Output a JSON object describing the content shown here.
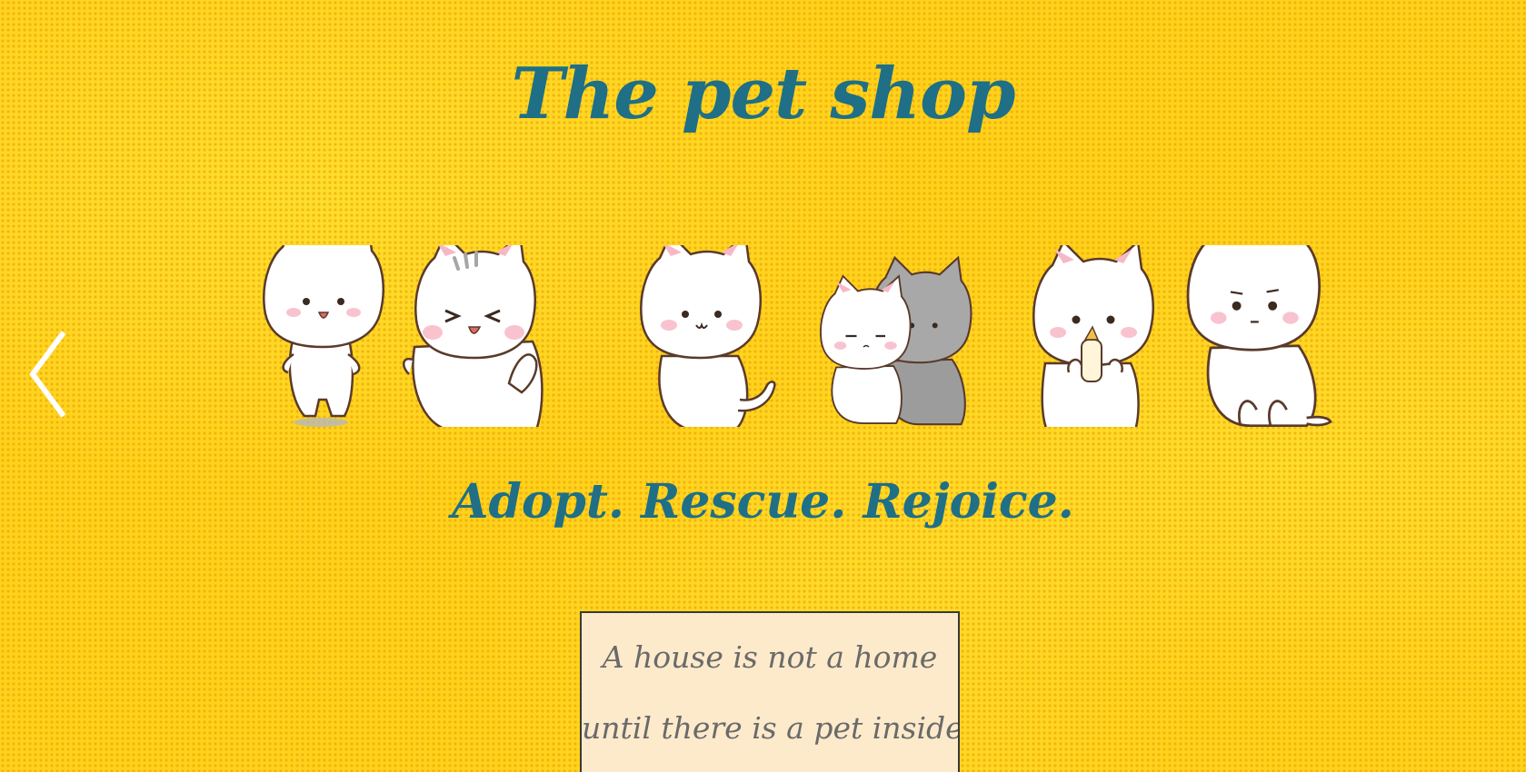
{
  "header": {
    "title": "The pet shop"
  },
  "carousel": {
    "prev_icon": "chevron-left-icon",
    "illustration": "row of six cartoon white kittens"
  },
  "tagline": "Adopt. Rescue. Rejoice.",
  "quote": {
    "line1": "A house is not a home",
    "line2": "until there is a pet inside."
  },
  "colors": {
    "background": "#ffd21a",
    "dots": "#e8960a",
    "heading": "#1f6f86",
    "quote_box_bg": "#fdeacb",
    "quote_text": "#6a6a6a"
  }
}
